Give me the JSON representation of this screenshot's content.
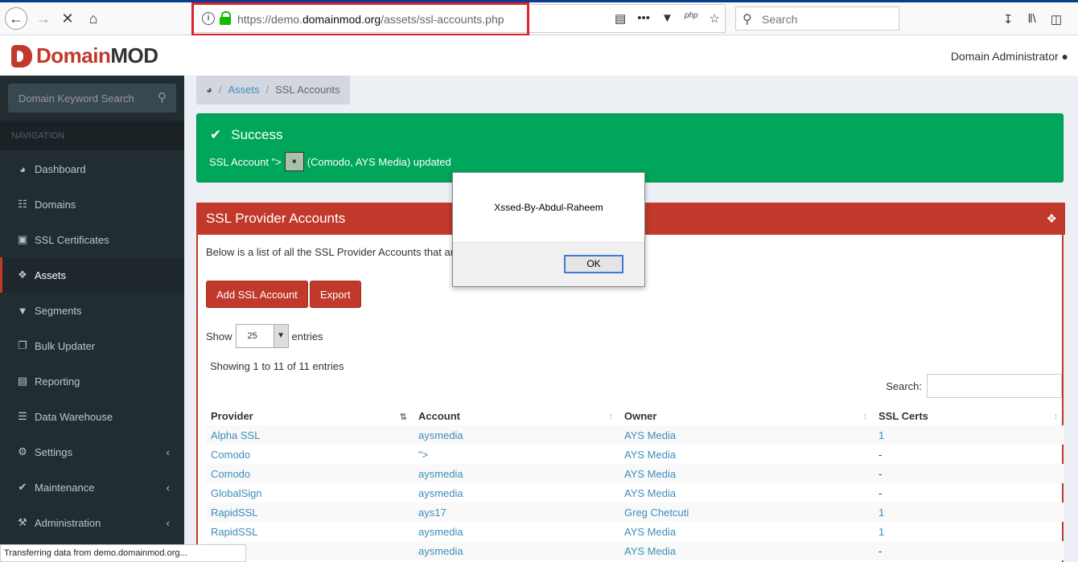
{
  "browser": {
    "url_prefix": "https://demo.",
    "url_domain": "domainmod.org",
    "url_path": "/assets/ssl-accounts.php",
    "search_placeholder": "Search",
    "php_label": "php",
    "status_text": "Transferring data from demo.domainmod.org..."
  },
  "header": {
    "logo_domain": "Domain",
    "logo_mod": "MOD",
    "user_name": "Domain Administrator"
  },
  "sidebar": {
    "search_placeholder": "Domain Keyword Search",
    "nav_header": "NAVIGATION",
    "items": [
      {
        "label": "Dashboard"
      },
      {
        "label": "Domains"
      },
      {
        "label": "SSL Certificates"
      },
      {
        "label": "Assets"
      },
      {
        "label": "Segments"
      },
      {
        "label": "Bulk Updater"
      },
      {
        "label": "Reporting"
      },
      {
        "label": "Data Warehouse"
      },
      {
        "label": "Settings"
      },
      {
        "label": "Maintenance"
      },
      {
        "label": "Administration"
      }
    ]
  },
  "breadcrumb": {
    "assets": "Assets",
    "current": "SSL Accounts"
  },
  "alert": {
    "title": "Success",
    "msg_before": "SSL Account \">",
    "msg_after": "(Comodo, AYS Media) updated"
  },
  "box": {
    "title": "SSL Provider Accounts",
    "intro": "Below is a list of all the SSL Provider Accounts that ar",
    "add_label": "Add SSL Account",
    "export_label": "Export",
    "show_label": "Show",
    "show_value": "25",
    "entries_label": "entries",
    "info": "Showing 1 to 11 of 11 entries",
    "search_label": "Search:"
  },
  "table": {
    "headers": [
      "Provider",
      "Account",
      "Owner",
      "SSL Certs"
    ],
    "rows": [
      [
        "Alpha SSL",
        "aysmedia",
        "AYS Media",
        "1"
      ],
      [
        "Comodo",
        "\">",
        "AYS Media",
        "-"
      ],
      [
        "Comodo",
        "aysmedia",
        "AYS Media",
        "-"
      ],
      [
        "GlobalSign",
        "aysmedia",
        "AYS Media",
        "-"
      ],
      [
        "RapidSSL",
        "ays17",
        "Greg Chetcuti",
        "1"
      ],
      [
        "RapidSSL",
        "aysmedia",
        "AYS Media",
        "1"
      ],
      [
        "",
        "aysmedia",
        "AYS Media",
        "-"
      ]
    ]
  },
  "modal": {
    "message": "Xssed-By-Abdul-Raheem",
    "ok_label": "OK"
  }
}
